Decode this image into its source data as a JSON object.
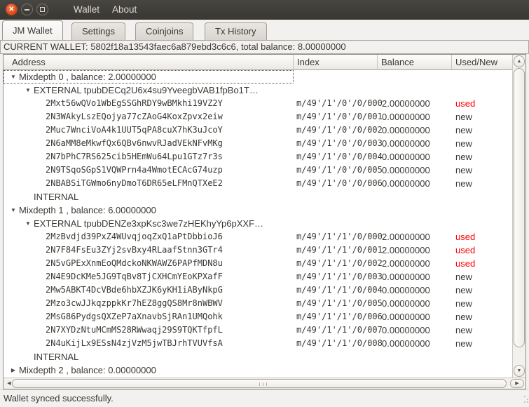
{
  "window": {
    "menus": [
      "Wallet",
      "About"
    ]
  },
  "tabs": [
    {
      "label": "JM Wallet",
      "active": true
    },
    {
      "label": "Settings",
      "active": false
    },
    {
      "label": "Coinjoins",
      "active": false
    },
    {
      "label": "Tx History",
      "active": false
    }
  ],
  "wallet_info": "CURRENT WALLET: 5802f18a13543faec6a879ebd3c6c6, total balance: 8.00000000",
  "table": {
    "columns": [
      "Address",
      "Index",
      "Balance",
      "Used/New"
    ],
    "rows": [
      {
        "level": 0,
        "expander": "open",
        "label": "Mixdepth 0 , balance: 2.00000000",
        "focused": true
      },
      {
        "level": 1,
        "expander": "open",
        "label": "EXTERNAL tpubDECq2U6x4su9YveegbVAB1fpBo1T…"
      },
      {
        "level": 2,
        "label": "2Mxt56wQVo1WbEgSSGhRDY9wBMkhi19VZ2Y",
        "index": "m/49'/1'/0'/0/000",
        "balance": "2.00000000",
        "status": "used"
      },
      {
        "level": 2,
        "label": "2N3WAkyLszEQojya77cZAoG4KoxZpvx2eiw",
        "index": "m/49'/1'/0'/0/001",
        "balance": "0.00000000",
        "status": "new"
      },
      {
        "level": 2,
        "label": "2Muc7WnciVoA4k1UUT5qPA8cuX7hK3uJcoY",
        "index": "m/49'/1'/0'/0/002",
        "balance": "0.00000000",
        "status": "new"
      },
      {
        "level": 2,
        "label": "2N6aMM8eMkwfQx6QBv6nwvRJadVEkNFvMKg",
        "index": "m/49'/1'/0'/0/003",
        "balance": "0.00000000",
        "status": "new"
      },
      {
        "level": 2,
        "label": "2N7bPhC7RS625cib5HEmWu64Lpu1GTz7r3s",
        "index": "m/49'/1'/0'/0/004",
        "balance": "0.00000000",
        "status": "new"
      },
      {
        "level": 2,
        "label": "2N9TSqoSGpS1VQWPrn4a4WmotECAcG74uzp",
        "index": "m/49'/1'/0'/0/005",
        "balance": "0.00000000",
        "status": "new"
      },
      {
        "level": 2,
        "label": "2NBABSiTGWmo6nyDmoT6DR65eLFMnQTXeE2",
        "index": "m/49'/1'/0'/0/006",
        "balance": "0.00000000",
        "status": "new"
      },
      {
        "level": 1,
        "label": "INTERNAL"
      },
      {
        "level": 0,
        "expander": "open",
        "label": "Mixdepth 1 , balance: 6.00000000"
      },
      {
        "level": 1,
        "expander": "open",
        "label": "EXTERNAL tpubDENZe3xpKsc3we7zHEKhyYp6pXXF…"
      },
      {
        "level": 2,
        "label": "2MzBvdjd39PxZ4WUvqjoqZxQ1aPtDbbioJ6",
        "index": "m/49'/1'/1'/0/000",
        "balance": "2.00000000",
        "status": "used"
      },
      {
        "level": 2,
        "label": "2N7F84FsEu3ZYj2svBxy4RLaafStnn3GTr4",
        "index": "m/49'/1'/1'/0/001",
        "balance": "2.00000000",
        "status": "used"
      },
      {
        "level": 2,
        "label": "2N5vGPExXnmEoQMdckoNKWAWZ6PAPfMDN8u",
        "index": "m/49'/1'/1'/0/002",
        "balance": "2.00000000",
        "status": "used"
      },
      {
        "level": 2,
        "label": "2N4E9DcKMe5JG9TqBv8TjCXHCmYEoKPXafF",
        "index": "m/49'/1'/1'/0/003",
        "balance": "0.00000000",
        "status": "new"
      },
      {
        "level": 2,
        "label": "2Mw5ABKT4DcVBde6hbXZJK6yKH1iAByNkpG",
        "index": "m/49'/1'/1'/0/004",
        "balance": "0.00000000",
        "status": "new"
      },
      {
        "level": 2,
        "label": "2Mzo3cwJJkqzppkKr7hEZ8ggQS8Mr8nWBWV",
        "index": "m/49'/1'/1'/0/005",
        "balance": "0.00000000",
        "status": "new"
      },
      {
        "level": 2,
        "label": "2MsG86PydgsQXZeP7aXnavbSjRAn1UMQohk",
        "index": "m/49'/1'/1'/0/006",
        "balance": "0.00000000",
        "status": "new"
      },
      {
        "level": 2,
        "label": "2N7XYDzNtuMCmMS28RWwaqj29S9TQKTfpfL",
        "index": "m/49'/1'/1'/0/007",
        "balance": "0.00000000",
        "status": "new"
      },
      {
        "level": 2,
        "label": "2N4uKijLx9ESsN4zjVzM5jwTBJrhTVUVfsA",
        "index": "m/49'/1'/1'/0/008",
        "balance": "0.00000000",
        "status": "new"
      },
      {
        "level": 1,
        "label": "INTERNAL"
      },
      {
        "level": 0,
        "expander": "closed",
        "label": "Mixdepth 2 , balance: 0.00000000"
      }
    ]
  },
  "status_bar": {
    "text": "Wallet synced successfully."
  },
  "colors": {
    "titlebar_bg": "#3c3a35",
    "close_button": "#dd4814",
    "used_status": "#ff0000",
    "window_bg": "#f2f1ef"
  },
  "icons": {
    "expander_open": "▼",
    "expander_closed": "▶",
    "scroll_up": "▲",
    "scroll_down": "▼",
    "scroll_left": "◀",
    "scroll_right": "▶",
    "close": "✕"
  }
}
